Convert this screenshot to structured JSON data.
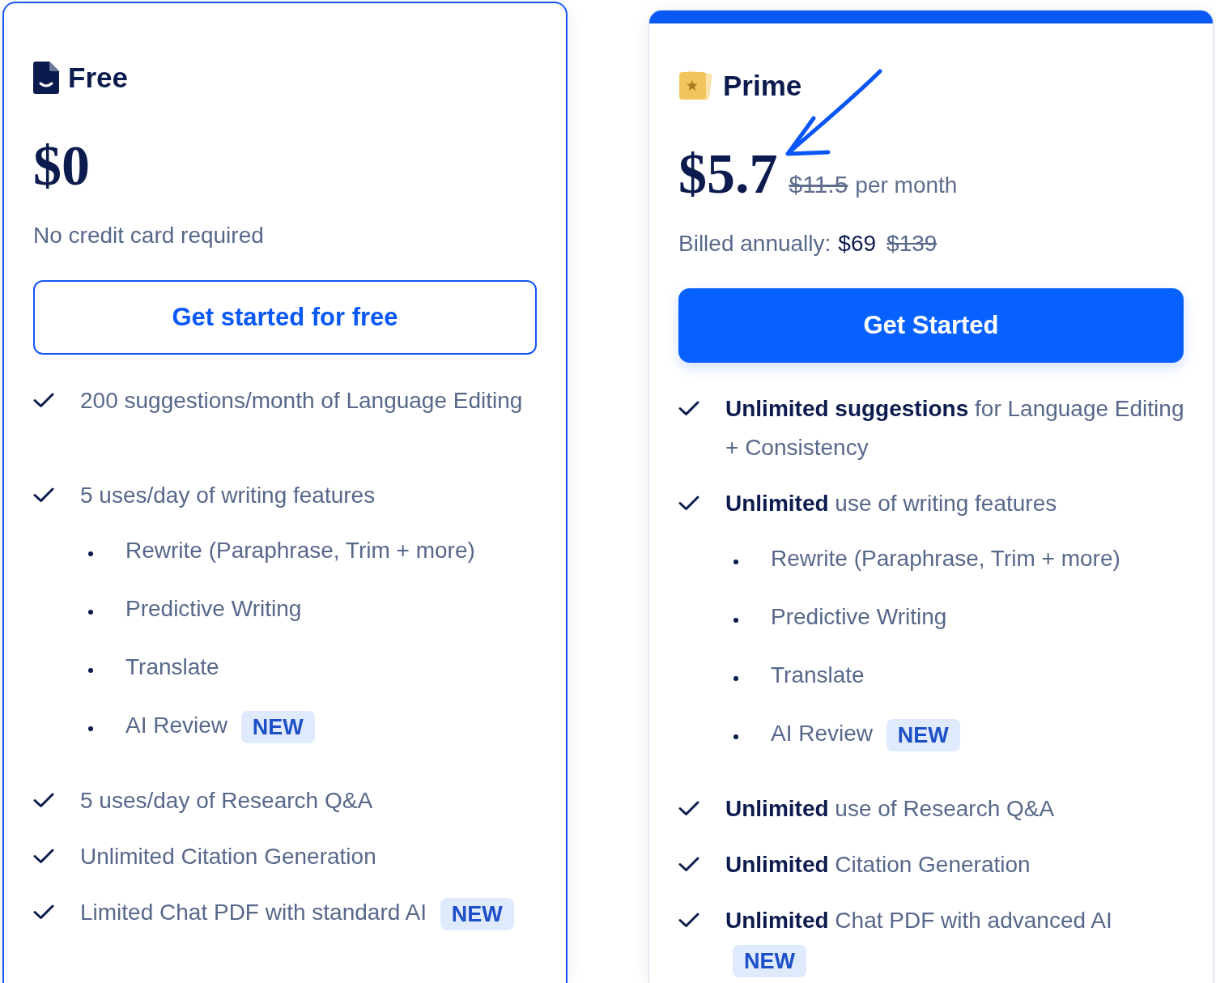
{
  "plans": [
    {
      "name": "Free",
      "selected": true,
      "featured": false,
      "price": {
        "amount": "$0"
      },
      "note": [
        {
          "kind": "text",
          "text": "No credit card required"
        }
      ],
      "button": {
        "label": "Get started for free",
        "kind": "outline"
      },
      "features": [
        {
          "text": "200 suggestions/month of Language Editing"
        },
        {
          "text": "5 uses/day of writing features",
          "sub_items": [
            {
              "text": "Rewrite (Paraphrase, Trim + more)"
            },
            {
              "text": "Predictive Writing"
            },
            {
              "text": "Translate"
            },
            {
              "text": "AI Review",
              "badge": "NEW"
            }
          ]
        },
        {
          "text": "5 uses/day of Research Q&A"
        },
        {
          "text": "Unlimited Citation Generation"
        },
        {
          "text": "Limited Chat PDF with standard AI",
          "badge": "NEW"
        }
      ]
    },
    {
      "name": "Prime",
      "selected": false,
      "featured": true,
      "price": {
        "amount": "$5.7",
        "original": "$11.5",
        "period": "per month"
      },
      "note": [
        {
          "kind": "text",
          "text": "Billed annually:"
        },
        {
          "kind": "price",
          "text": "$69"
        },
        {
          "kind": "old_price",
          "text": "$139"
        }
      ],
      "button": {
        "label": "Get Started",
        "kind": "primary"
      },
      "features": [
        {
          "text": "**Unlimited suggestions** for Language Editing + Consistency"
        },
        {
          "text": "**Unlimited** use of writing features",
          "sub_items": [
            {
              "text": "Rewrite (Paraphrase, Trim + more)"
            },
            {
              "text": "Predictive Writing"
            },
            {
              "text": "Translate"
            },
            {
              "text": "AI Review",
              "badge": "NEW"
            }
          ]
        },
        {
          "text": "**Unlimited** use of Research Q&A"
        },
        {
          "text": "**Unlimited** Citation Generation"
        },
        {
          "text": "**Unlimited** Chat PDF with advanced AI",
          "badge": "NEW"
        }
      ]
    }
  ]
}
